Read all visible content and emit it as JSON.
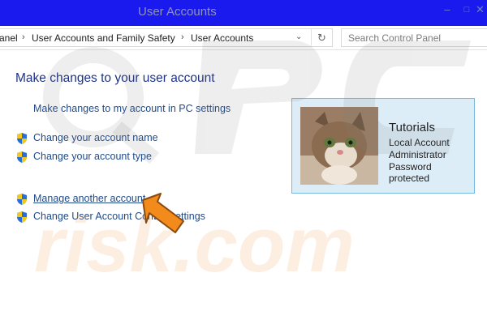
{
  "window": {
    "title": "User Accounts"
  },
  "title_buttons": {
    "minimize": "–",
    "maximize": "□",
    "close": "✕"
  },
  "address_bar": {
    "crumbs": [
      "anel",
      "User Accounts and Family Safety",
      "User Accounts"
    ],
    "separator": "›",
    "dropdown_glyph": "⌄",
    "refresh_glyph": "↻"
  },
  "search": {
    "placeholder": "Search Control Panel"
  },
  "main": {
    "heading": "Make changes to your user account",
    "pc_settings_link": "Make changes to my account in PC settings",
    "tasks": [
      {
        "label": "Change your account name",
        "icon": "uac-shield-icon"
      },
      {
        "label": "Change your account type",
        "icon": "uac-shield-icon"
      },
      {
        "label": "Manage another account",
        "icon": "uac-shield-icon"
      },
      {
        "label": "Change User Account Control settings",
        "icon": "uac-shield-icon"
      }
    ]
  },
  "account": {
    "name": "Tutorials",
    "type": "Local Account",
    "role": "Administrator",
    "password_status": "Password protected",
    "avatar": "kitten-photo"
  },
  "colors": {
    "titlebar": "#1a1aee",
    "link": "#1f4a8a",
    "heading": "#1e3287",
    "card_bg": "#dcedf7",
    "card_border": "#74b9de",
    "arrow": "#f28a1c"
  }
}
